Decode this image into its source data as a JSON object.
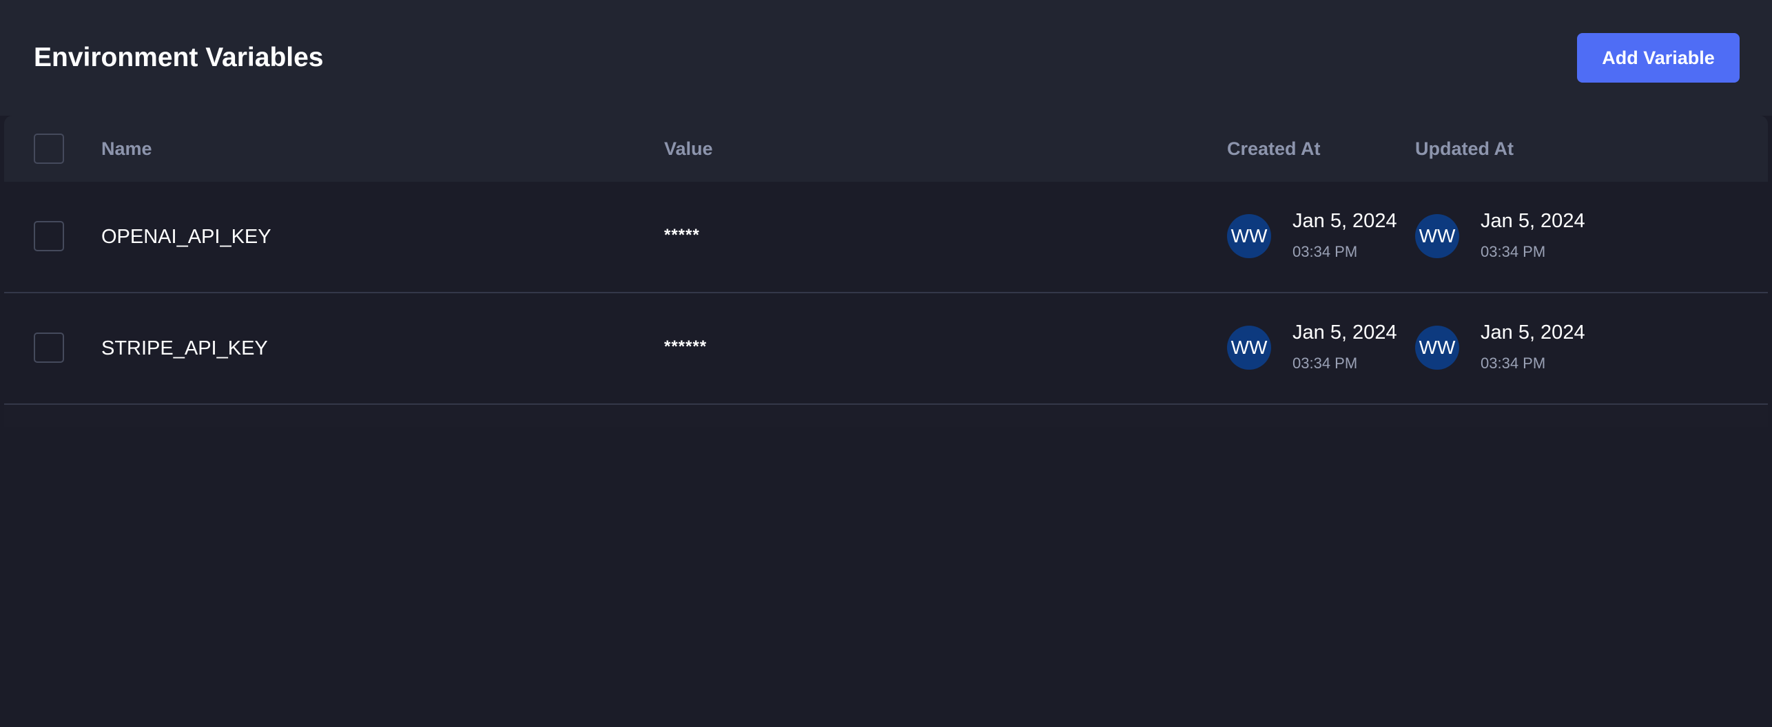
{
  "header": {
    "title": "Environment Variables",
    "add_button_label": "Add Variable"
  },
  "table": {
    "columns": {
      "name": "Name",
      "value": "Value",
      "created_at": "Created At",
      "updated_at": "Updated At"
    },
    "rows": [
      {
        "name": "OPENAI_API_KEY",
        "value": "*****",
        "created": {
          "avatar": "WW",
          "date": "Jan 5, 2024",
          "time": "03:34 PM"
        },
        "updated": {
          "avatar": "WW",
          "date": "Jan 5, 2024",
          "time": "03:34 PM"
        }
      },
      {
        "name": "STRIPE_API_KEY",
        "value": "******",
        "created": {
          "avatar": "WW",
          "date": "Jan 5, 2024",
          "time": "03:34 PM"
        },
        "updated": {
          "avatar": "WW",
          "date": "Jan 5, 2024",
          "time": "03:34 PM"
        }
      }
    ]
  },
  "colors": {
    "page_background": "#1b1c28",
    "header_background": "#222531",
    "accent": "#4f6df5",
    "avatar_background": "#0d3a7f",
    "muted_text": "#8d95ad"
  }
}
